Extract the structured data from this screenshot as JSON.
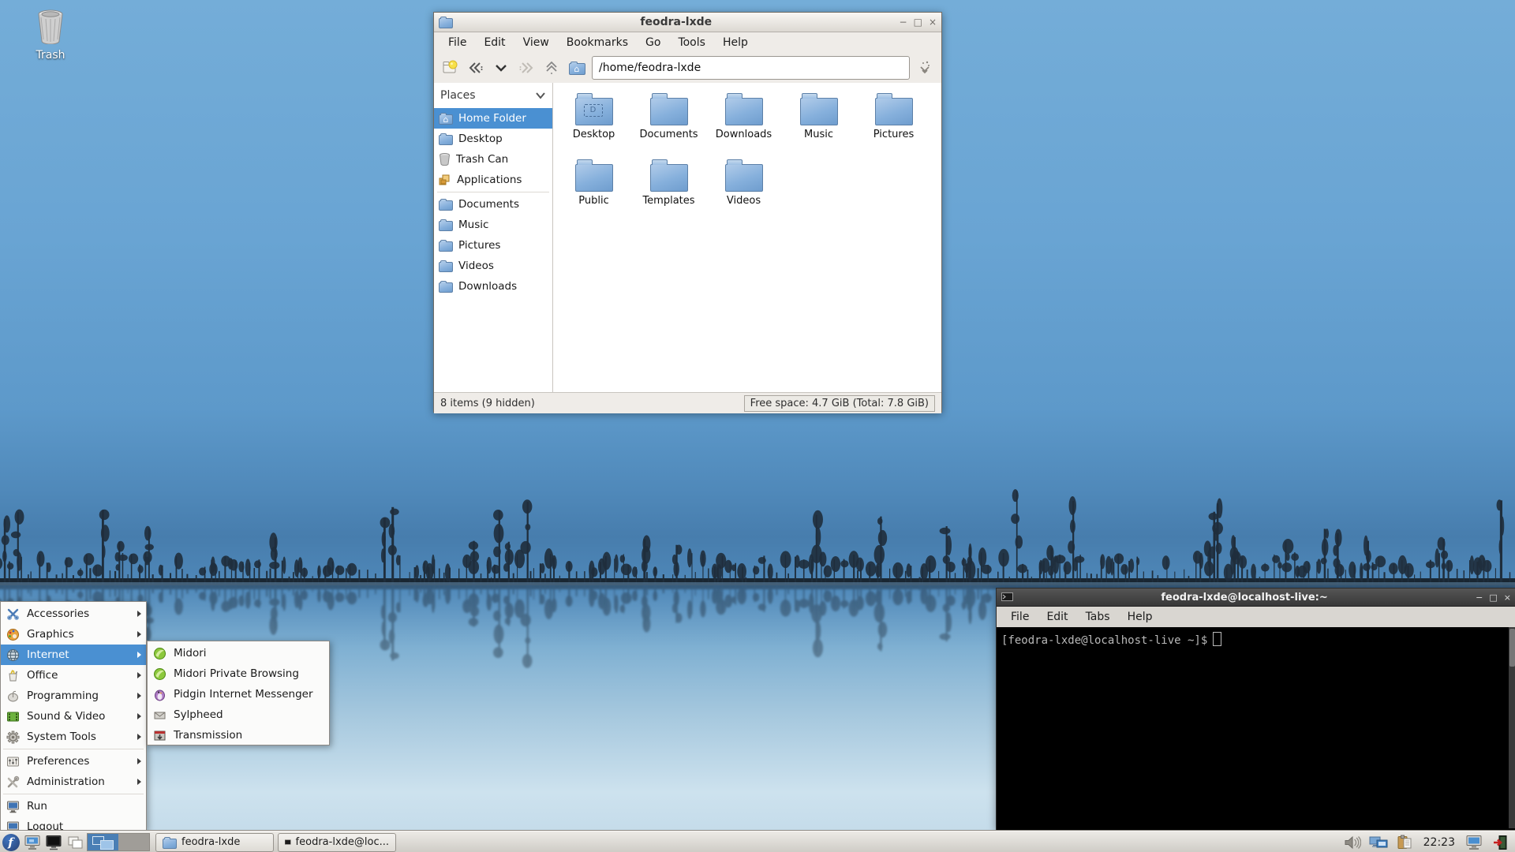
{
  "desktop": {
    "trash_label": "Trash"
  },
  "icons": {
    "minimize": "−",
    "maximize": "□",
    "close": "×"
  },
  "file_manager": {
    "title": "feodra-lxde",
    "menubar": [
      "File",
      "Edit",
      "View",
      "Bookmarks",
      "Go",
      "Tools",
      "Help"
    ],
    "address": "/home/feodra-lxde",
    "places": {
      "header": "Places",
      "items": [
        "Home Folder",
        "Desktop",
        "Trash Can",
        "Applications",
        "Documents",
        "Music",
        "Pictures",
        "Videos",
        "Downloads"
      ]
    },
    "folders": [
      "Desktop",
      "Documents",
      "Downloads",
      "Music",
      "Pictures",
      "Public",
      "Templates",
      "Videos"
    ],
    "desktop_emblem": "D",
    "statusbar": {
      "left": "8 items (9 hidden)",
      "right": "Free space: 4.7 GiB (Total: 7.8 GiB)"
    }
  },
  "terminal": {
    "title": "feodra-lxde@localhost-live:~",
    "menubar": [
      "File",
      "Edit",
      "Tabs",
      "Help"
    ],
    "prompt": "[feodra-lxde@localhost-live ~]$"
  },
  "start_menu": {
    "items": [
      {
        "label": "Accessories"
      },
      {
        "label": "Graphics"
      },
      {
        "label": "Internet"
      },
      {
        "label": "Office"
      },
      {
        "label": "Programming"
      },
      {
        "label": "Sound & Video"
      },
      {
        "label": "System Tools"
      },
      {
        "label": "Preferences"
      },
      {
        "label": "Administration"
      },
      {
        "label": "Run"
      },
      {
        "label": "Logout"
      }
    ]
  },
  "internet_submenu": [
    "Midori",
    "Midori Private Browsing",
    "Pidgin Internet Messenger",
    "Sylpheed",
    "Transmission"
  ],
  "taskbar": {
    "tasks": [
      {
        "label": "feodra-lxde"
      },
      {
        "label": "feodra-lxde@loc..."
      }
    ],
    "clock": "22:23"
  }
}
